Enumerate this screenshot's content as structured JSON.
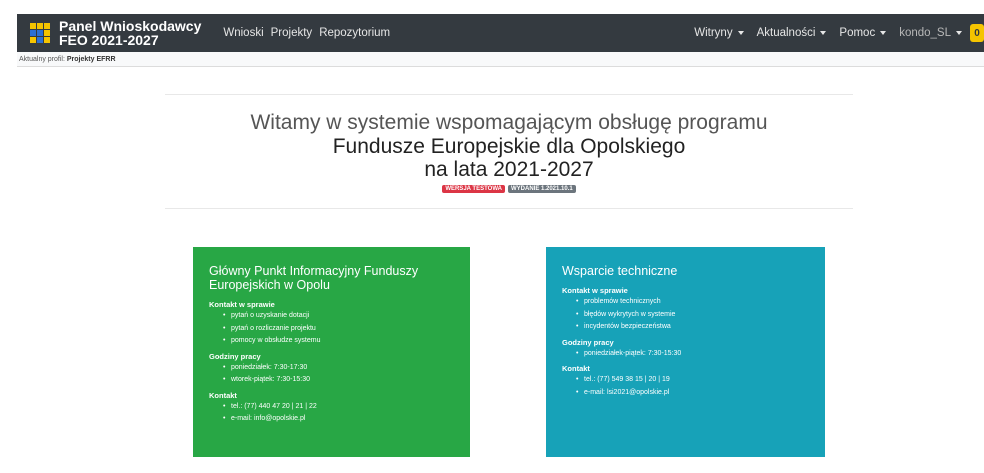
{
  "navbar": {
    "brand_line1": "Panel Wnioskodawcy",
    "brand_line2": "FEO 2021-2027",
    "left_links": [
      "Wnioski",
      "Projekty",
      "Repozytorium"
    ],
    "right_links": [
      "Witryny",
      "Aktualności",
      "Pomoc"
    ],
    "user": "kondo_SL",
    "coin": "0"
  },
  "profile": {
    "label": "Aktualny profil:",
    "value": "Projekty EFRR"
  },
  "hero": {
    "line1": "Witamy w systemie wspomagającym obsługę programu",
    "line2": "Fundusze Europejskie dla Opolskiego",
    "line3": "na lata 2021-2027",
    "badge_test": "WERSJA TESTOWA",
    "badge_release": "WYDANIE 1.2021.10.1"
  },
  "green_card": {
    "title": "Główny Punkt Informacyjny Funduszy Europejskich w Opolu",
    "contact_heading": "Kontakt w sprawie",
    "contact_items": [
      "pytań o uzyskanie dotacji",
      "pytań o rozliczanie projektu",
      "pomocy w obsłudze systemu"
    ],
    "hours_heading": "Godziny pracy",
    "hours_items": [
      "poniedziałek: 7:30-17:30",
      "wtorek-piątek: 7:30-15:30"
    ],
    "kontakt_heading": "Kontakt",
    "kontakt_items": [
      "tel.: (77) 440 47 20 | 21 | 22",
      "e-mail: info@opolskie.pl"
    ]
  },
  "teal_card": {
    "title": "Wsparcie techniczne",
    "contact_heading": "Kontakt w sprawie",
    "contact_items": [
      "problemów technicznych",
      "błędów wykrytych w systemie",
      "incydentów bezpieczeństwa"
    ],
    "hours_heading": "Godziny pracy",
    "hours_items": [
      "poniedziałek-piątek: 7:30-15:30"
    ],
    "kontakt_heading": "Kontakt",
    "kontakt_items": [
      "tel.: (77) 549 38 15 | 20 | 19",
      "e-mail: lsi2021@opolskie.pl"
    ]
  },
  "colors": {
    "navbar": "#343a40",
    "green": "#28a745",
    "teal": "#17a2b8",
    "logo_yellow": "#f5c400",
    "logo_blue": "#2b6fd6"
  }
}
